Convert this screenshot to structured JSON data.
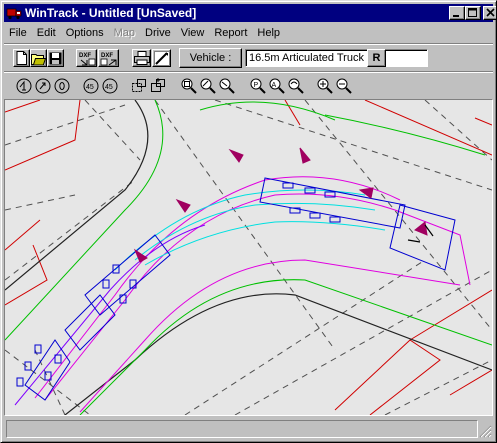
{
  "window": {
    "title": "WinTrack - Untitled [UnSaved]",
    "app_icon": "truck-app-icon",
    "controls": [
      {
        "name": "minimize-button",
        "icon": "minimize-icon"
      },
      {
        "name": "maximize-button",
        "icon": "maximize-icon"
      },
      {
        "name": "close-button",
        "icon": "close-icon"
      }
    ]
  },
  "menu": {
    "items": [
      {
        "label": "File",
        "enabled": true
      },
      {
        "label": "Edit",
        "enabled": true
      },
      {
        "label": "Options",
        "enabled": true
      },
      {
        "label": "Map",
        "enabled": false
      },
      {
        "label": "Drive",
        "enabled": true
      },
      {
        "label": "View",
        "enabled": true
      },
      {
        "label": "Report",
        "enabled": true
      },
      {
        "label": "Help",
        "enabled": true
      }
    ]
  },
  "toolbar1": {
    "buttons": [
      {
        "icon": "new-file-icon"
      },
      {
        "icon": "open-folder-icon"
      },
      {
        "icon": "save-disk-icon"
      },
      {
        "icon": "dxf-import-icon",
        "label": "DXF"
      },
      {
        "icon": "dxf-export-icon",
        "label": "DXF"
      },
      {
        "icon": "print-icon"
      },
      {
        "icon": "draw-path-icon"
      }
    ],
    "vehicle_button_label": "Vehicle :",
    "vehicle_value": "16.5m Articulated Truck"
  },
  "toolbar2": {
    "buttons": [
      {
        "icon": "rotate-left-icon"
      },
      {
        "icon": "rotate-right-icon"
      },
      {
        "icon": "rotate-zero-icon"
      },
      {
        "icon": "rotate-left-45-icon"
      },
      {
        "icon": "rotate-right-45-icon"
      },
      {
        "icon": "select-region-icon"
      },
      {
        "icon": "move-region-icon"
      },
      {
        "icon": "zoom-window-icon"
      },
      {
        "icon": "zoom-in-step-icon"
      },
      {
        "icon": "zoom-out-step-icon"
      },
      {
        "icon": "pan-icon"
      },
      {
        "icon": "zoom-all-icon"
      },
      {
        "icon": "zoom-previous-icon"
      },
      {
        "icon": "zoom-in-icon"
      },
      {
        "icon": "zoom-out-icon"
      },
      {
        "icon": "redraw-icon",
        "label": "R"
      }
    ]
  },
  "colors": {
    "title_bar": "#000080",
    "background_lines": "#5a5a5a",
    "property_lines": "#d00000",
    "kerb_lines": "#00c000",
    "envelope": "#e000e0",
    "wheel_paths": "#00e0e0",
    "vehicle": "#0000d0",
    "markers": "#a00060"
  },
  "status": {
    "text": ""
  }
}
